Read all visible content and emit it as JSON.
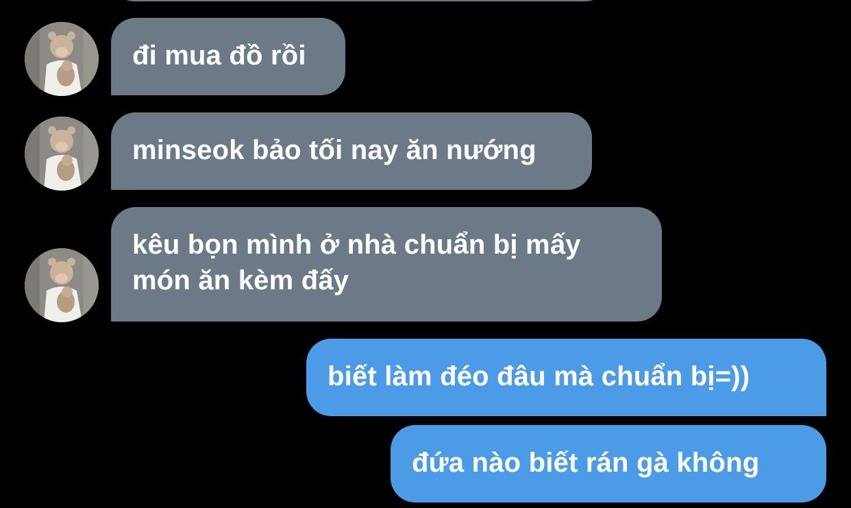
{
  "colors": {
    "background": "#000000",
    "received_bubble": "#6c7a88",
    "sent_bubble": "#4b9be7",
    "text": "#ffffff"
  },
  "chat": {
    "contact_avatar_icon": "avatar-photo-person-with-bear-hat",
    "messages": [
      {
        "direction": "received",
        "text": ""
      },
      {
        "direction": "received",
        "text": "đi mua đồ rồi"
      },
      {
        "direction": "received",
        "text": "minseok bảo tối nay ăn nướng"
      },
      {
        "direction": "received",
        "lines": [
          "kêu bọn mình ở nhà chuẩn bị mấy",
          "món ăn kèm đấy"
        ]
      },
      {
        "direction": "sent",
        "text": "biết làm đéo đâu mà chuẩn bị=))"
      },
      {
        "direction": "sent",
        "text": "đứa nào biết rán gà không"
      }
    ]
  }
}
